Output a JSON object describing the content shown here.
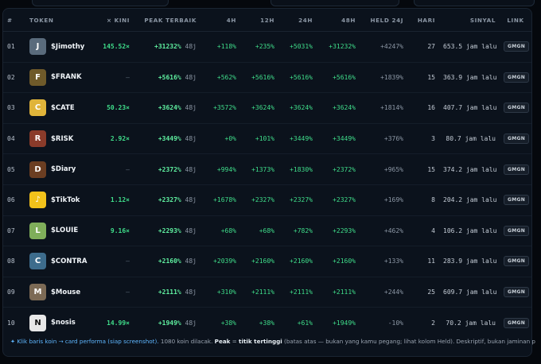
{
  "columns": [
    "#",
    "TOKEN",
    "× KINI",
    "PEAK TERBAIK",
    "4H",
    "12H",
    "24H",
    "48H",
    "HELD 24J",
    "HARI",
    "SINYAL",
    "LINK"
  ],
  "rows": [
    {
      "idx": "01",
      "name": "$Jimothy",
      "kini": "145.52×",
      "peak": "+31232%",
      "peak_unit": "48j",
      "h4": "+118%",
      "h12": "+235%",
      "h24": "+5031%",
      "h48": "+31232%",
      "held": "+4247%",
      "hari": "27",
      "sinyal": "653.5 jam lalu",
      "link": "GMGN",
      "avatar_bg": "#5a6b7c",
      "avatar_glyph": "J"
    },
    {
      "idx": "02",
      "name": "$FRANK",
      "kini": "—",
      "peak": "+5616%",
      "peak_unit": "48j",
      "h4": "+562%",
      "h12": "+5616%",
      "h24": "+5616%",
      "h48": "+5616%",
      "held": "+1839%",
      "hari": "15",
      "sinyal": "363.9 jam lalu",
      "link": "GMGN",
      "avatar_bg": "#6f5a2a",
      "avatar_glyph": "F"
    },
    {
      "idx": "03",
      "name": "$CATE",
      "kini": "50.23×",
      "peak": "+3624%",
      "peak_unit": "48j",
      "h4": "+3572%",
      "h12": "+3624%",
      "h24": "+3624%",
      "h48": "+3624%",
      "held": "+1814%",
      "hari": "16",
      "sinyal": "407.7 jam lalu",
      "link": "GMGN",
      "avatar_bg": "#e0b43a",
      "avatar_glyph": "C"
    },
    {
      "idx": "04",
      "name": "$RISK",
      "kini": "2.92×",
      "peak": "+3449%",
      "peak_unit": "48j",
      "h4": "+0%",
      "h12": "+101%",
      "h24": "+3449%",
      "h48": "+3449%",
      "held": "+376%",
      "hari": "3",
      "sinyal": "80.7 jam lalu",
      "link": "GMGN",
      "avatar_bg": "#8a3b2a",
      "avatar_glyph": "R"
    },
    {
      "idx": "05",
      "name": "$Diary",
      "kini": "—",
      "peak": "+2372%",
      "peak_unit": "48j",
      "h4": "+994%",
      "h12": "+1373%",
      "h24": "+1830%",
      "h48": "+2372%",
      "held": "+965%",
      "hari": "15",
      "sinyal": "374.2 jam lalu",
      "link": "GMGN",
      "avatar_bg": "#6b3e22",
      "avatar_glyph": "D"
    },
    {
      "idx": "06",
      "name": "$TikTok",
      "kini": "1.12×",
      "peak": "+2327%",
      "peak_unit": "48j",
      "h4": "+1678%",
      "h12": "+2327%",
      "h24": "+2327%",
      "h48": "+2327%",
      "held": "+169%",
      "hari": "8",
      "sinyal": "204.2 jam lalu",
      "link": "GMGN",
      "avatar_bg": "#f2c21b",
      "avatar_glyph": "♪"
    },
    {
      "idx": "07",
      "name": "$LOUIE",
      "kini": "9.16×",
      "peak": "+2293%",
      "peak_unit": "48j",
      "h4": "+68%",
      "h12": "+68%",
      "h24": "+782%",
      "h48": "+2293%",
      "held": "+462%",
      "hari": "4",
      "sinyal": "106.2 jam lalu",
      "link": "GMGN",
      "avatar_bg": "#7fae5a",
      "avatar_glyph": "L"
    },
    {
      "idx": "08",
      "name": "$CONTRA",
      "kini": "—",
      "peak": "+2160%",
      "peak_unit": "48j",
      "h4": "+2039%",
      "h12": "+2160%",
      "h24": "+2160%",
      "h48": "+2160%",
      "held": "+133%",
      "hari": "11",
      "sinyal": "283.9 jam lalu",
      "link": "GMGN",
      "avatar_bg": "#3d6c8c",
      "avatar_glyph": "C"
    },
    {
      "idx": "09",
      "name": "$Mouse",
      "kini": "—",
      "peak": "+2111%",
      "peak_unit": "48j",
      "h4": "+310%",
      "h12": "+2111%",
      "h24": "+2111%",
      "h48": "+2111%",
      "held": "+244%",
      "hari": "25",
      "sinyal": "609.7 jam lalu",
      "link": "GMGN",
      "avatar_bg": "#7c6a55",
      "avatar_glyph": "M"
    },
    {
      "idx": "10",
      "name": "$nosis",
      "kini": "14.99×",
      "peak": "+1949%",
      "peak_unit": "48j",
      "h4": "+38%",
      "h12": "+38%",
      "h24": "+61%",
      "h48": "+1949%",
      "held": "-10%",
      "hari": "2",
      "sinyal": "70.2 jam lalu",
      "link": "GMGN",
      "avatar_bg": "#e8e8e8",
      "avatar_glyph": "N"
    }
  ],
  "footer": {
    "hint": "Klik baris koin → card performa (siap screenshot).",
    "count": "1080 koin dilacak.",
    "peak_label": "Peak",
    "eq": " = ",
    "peak_def": "titik tertinggi",
    "rest": " (batas atas — bukan yang kamu pegang; lihat kolom Held). Deskriptif, bukan jaminan profit."
  },
  "colors": {
    "accent_green": "#3fdd8a",
    "peak_green": "#5ff0a0",
    "background": "#05080d",
    "panel": "#0b121c"
  }
}
